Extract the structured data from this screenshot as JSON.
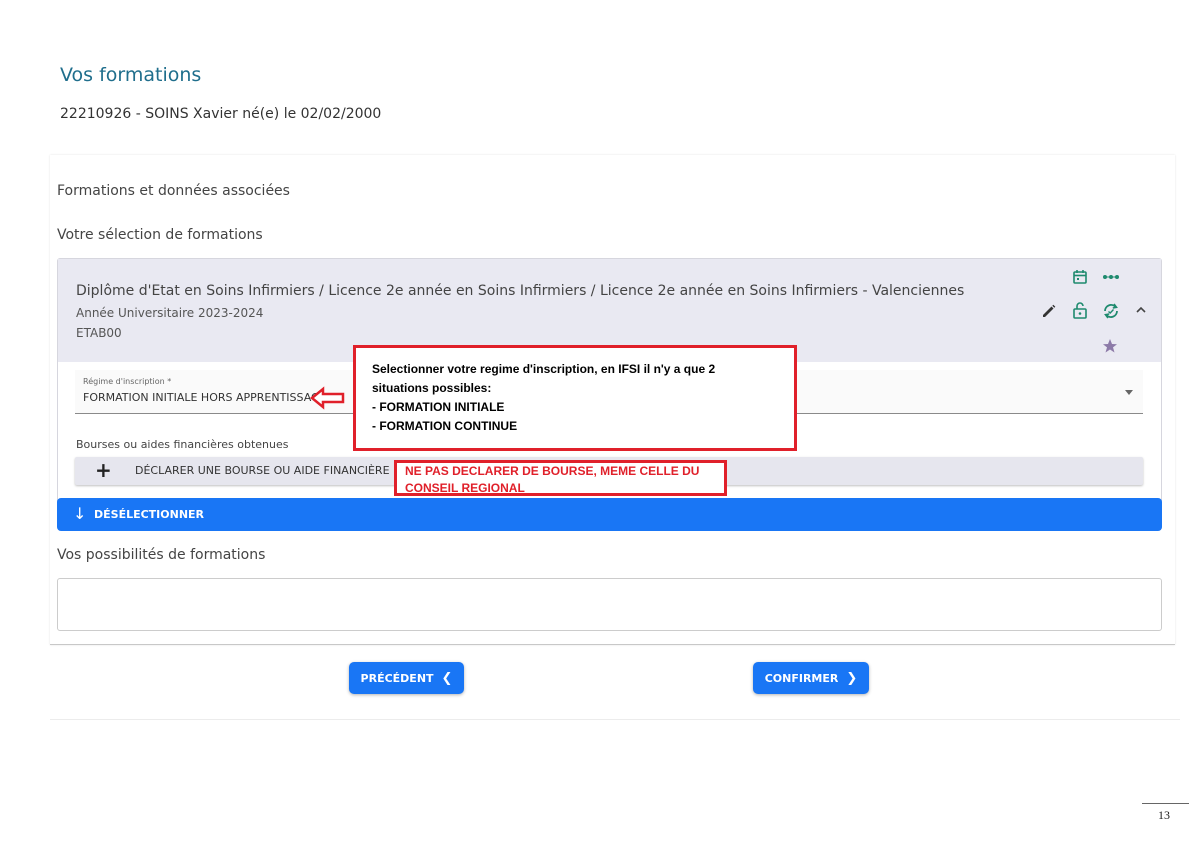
{
  "header": {
    "title": "Vos formations",
    "student": "22210926 - SOINS Xavier né(e) le 02/02/2000"
  },
  "sections": {
    "formations_label": "Formations et données associées",
    "selection_label": "Votre sélection de formations",
    "possibilites_label": "Vos possibilités de formations"
  },
  "formation": {
    "title": "Diplôme d'Etat en Soins Infirmiers / Licence 2e année en Soins Infirmiers / Licence 2e année en Soins Infirmiers - Valenciennes",
    "year": "Année Universitaire 2023-2024",
    "etab": "ETAB00",
    "icons": [
      "calendar-icon",
      "more-dots-icon",
      "edit-pencil-icon",
      "lock-open-icon",
      "sync-icon",
      "chevron-up-icon",
      "star-icon"
    ],
    "icon_color_teal": "#1e8a6e",
    "icon_color_dark": "#333333",
    "icon_color_star": "#8c7aa8"
  },
  "regime": {
    "caption": "Régime d'inscription *",
    "value": "FORMATION INITIALE HORS APPRENTISSAGE"
  },
  "bourses": {
    "label": "Bourses ou aides financières obtenues",
    "plus": "+",
    "declare_label": "DÉCLARER UNE BOURSE OU AIDE FINANCIÈRE"
  },
  "deselect": {
    "arrow": "↓",
    "label": "DÉSÉLECTIONNER"
  },
  "buttons": {
    "prev_label": "PRÉCÉDENT",
    "prev_chev": "❮",
    "next_label": "CONFIRMER",
    "next_chev": "❯"
  },
  "annotations": {
    "regime_note": {
      "line1": "Selectionner votre regime d'inscription, en IFSI il n'y a que 2",
      "line2": "situations possibles:",
      "line3": "- FORMATION INITIALE",
      "line4": "- FORMATION CONTINUE"
    },
    "bourse_warning": {
      "line1": "NE PAS DECLARER DE BOURSE, MEME CELLE DU",
      "line2": "CONSEIL REGIONAL"
    },
    "accent_red": "#e0202a"
  },
  "page_number": "13",
  "colors": {
    "primary_blue": "#1976f5",
    "title_teal": "#1f6e8c",
    "header_bg": "#e9e9f2"
  }
}
